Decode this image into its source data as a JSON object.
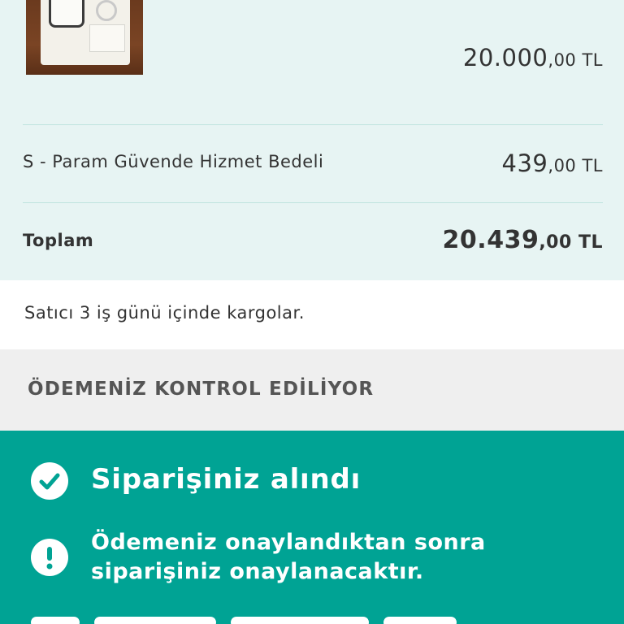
{
  "order_summary": {
    "product": {
      "image_alt": "product photo",
      "price_main": "20.000",
      "price_decimal": ",00 TL"
    },
    "service_fee": {
      "label": "S - Param Güvende Hizmet Bedeli",
      "price_main": "439",
      "price_decimal": ",00 TL"
    },
    "total": {
      "label": "Toplam",
      "price_main": "20.439",
      "price_decimal": ",00 TL"
    }
  },
  "shipping": {
    "text": "Satıcı 3 iş günü içinde kargolar."
  },
  "payment_status": {
    "text": "ÖDEMENİZ KONTROL EDİLİYOR"
  },
  "notice": {
    "title": "Siparişiniz alındı",
    "body_line1": "Ödemeniz onaylandıktan sonra",
    "body_line2": "siparişiniz onaylanacaktır.",
    "title_icon": "check-circle-icon",
    "body_icon": "exclamation-circle-icon"
  },
  "colors": {
    "summary_bg": "#e7f4f3",
    "status_bg": "#efefef",
    "notice_bg": "#00a394",
    "text": "#333333"
  }
}
